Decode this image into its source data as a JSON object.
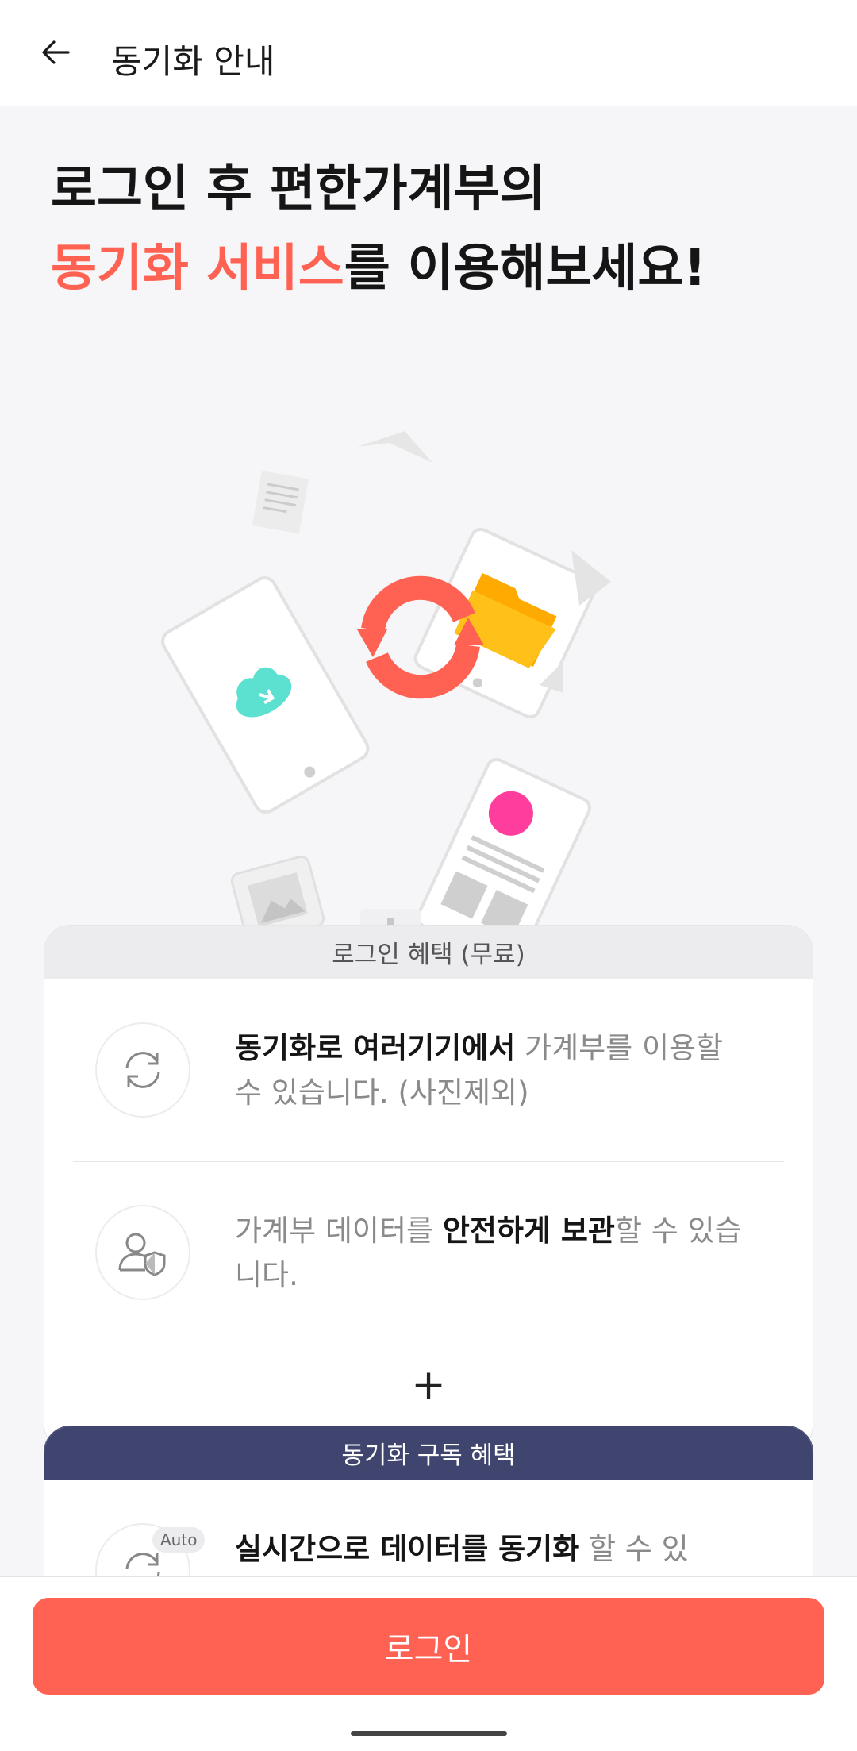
{
  "appbar": {
    "title": "동기화 안내",
    "back_icon": "arrow-left-icon"
  },
  "headline": {
    "line1": "로그인 후 편한가계부의",
    "line2_accent": "동기화 서비스",
    "line2_rest": "를 이용해보세요!",
    "accent_color": "#ff6152"
  },
  "free_card": {
    "header": "로그인 혜택 (무료)",
    "items": [
      {
        "icon": "sync-icon",
        "bold": "동기화로 여러기기에서",
        "rest": " 가계부를 이용할 수 있습니다. (사진제외)"
      },
      {
        "icon": "user-shield-icon",
        "pre": "가계부 데이터를 ",
        "bold": "안전하게 보관",
        "rest": "할 수 있습니다."
      }
    ]
  },
  "plus": "+",
  "sub_card": {
    "header": "동기화 구독 혜택",
    "badge": "Auto",
    "item": {
      "icon": "auto-sync-icon",
      "bold": "실시간으로 데이터를 동기화",
      "rest": " 할 수 있"
    }
  },
  "bottom": {
    "login_label": "로그인",
    "brand_color": "#ff6152"
  }
}
